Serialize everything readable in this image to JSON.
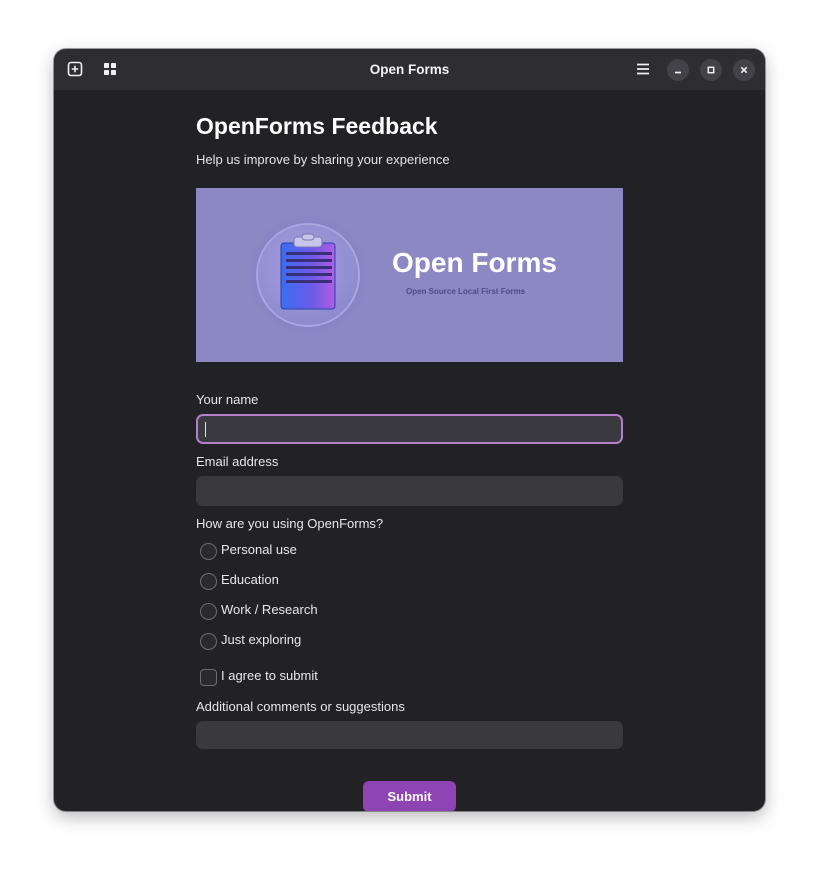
{
  "window": {
    "title": "Open Forms"
  },
  "header": {
    "title": "OpenForms Feedback",
    "subtitle": "Help us improve by sharing your experience"
  },
  "banner": {
    "title": "Open Forms",
    "subtitle": "Open Source Local First Forms"
  },
  "form": {
    "name_label": "Your name",
    "name_value": "",
    "email_label": "Email address",
    "email_value": "",
    "usage_label": "How are you using OpenForms?",
    "usage_options": [
      "Personal use",
      "Education",
      "Work / Research",
      "Just exploring"
    ],
    "agree_label": "I agree to submit",
    "agree_checked": false,
    "comments_label": "Additional comments or suggestions",
    "comments_value": "",
    "submit_label": "Submit"
  },
  "colors": {
    "window_bg": "#222226",
    "titlebar_bg": "#2e2e32",
    "accent": "#8e45b3",
    "focus_ring": "#b47ec8",
    "banner_bg": "#8b88c4"
  },
  "icons": {
    "titlebar_left": [
      "new-tab-icon",
      "grid-icon"
    ],
    "titlebar_right": [
      "hamburger-menu-icon",
      "minimize-icon",
      "maximize-icon",
      "close-icon"
    ],
    "banner": "clipboard-icon"
  }
}
